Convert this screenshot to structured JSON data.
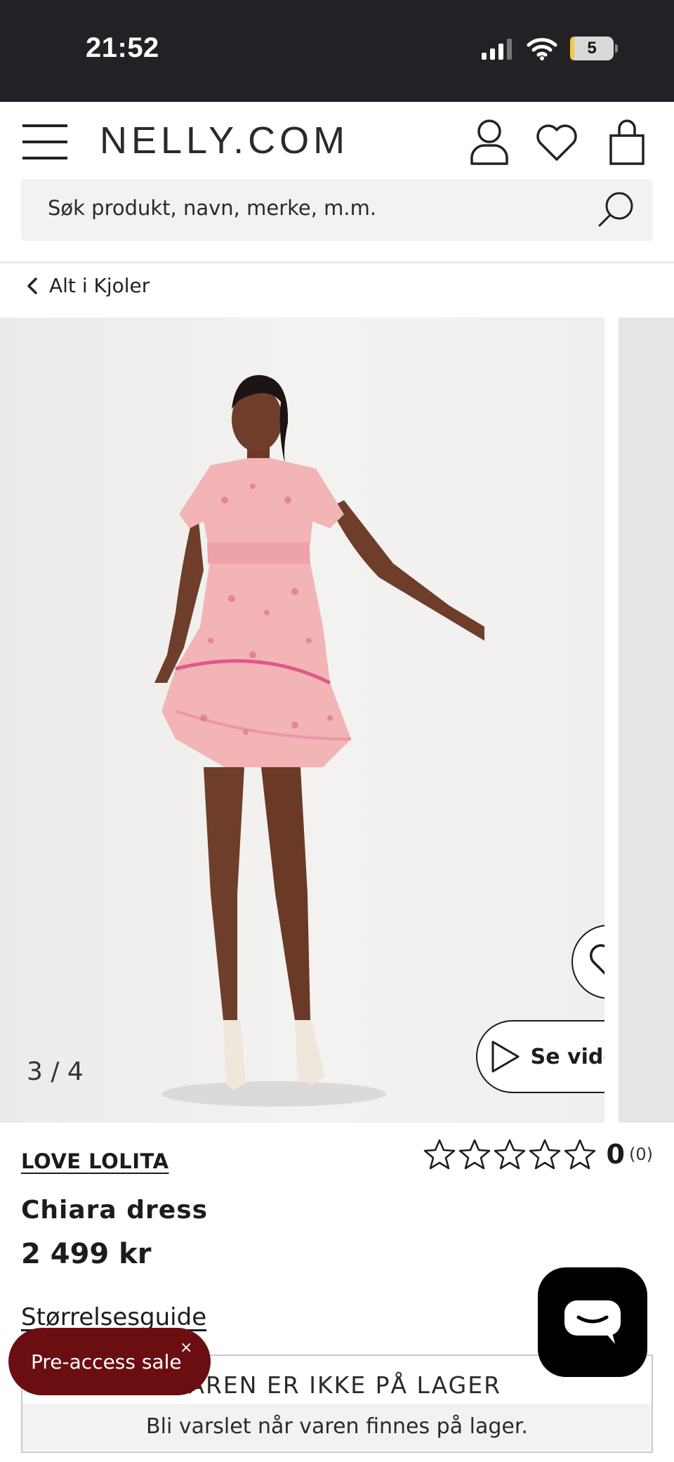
{
  "status_bar": {
    "time": "21:52",
    "battery": "5"
  },
  "header": {
    "logo": "NELLY.COM",
    "search_placeholder": "Søk produkt, navn, merke, m.m."
  },
  "breadcrumb": {
    "label": "Alt i Kjoler"
  },
  "gallery": {
    "counter": "3 / 4",
    "video_label": "Se video"
  },
  "product": {
    "brand": "LOVE LOLITA",
    "name": "Chiara dress",
    "price": "2 499 kr",
    "rating_value": "0",
    "rating_count": "(0)",
    "rating_stars": 0,
    "size_guide": "Størrelsesguide"
  },
  "stock": {
    "title": "VAREN ER IKKE PÅ LAGER",
    "subtitle": "Bli varslet når varen finnes på lager."
  },
  "promo": {
    "label": "Pre-access sale",
    "close": "×"
  },
  "colors": {
    "status_bar": "#222226",
    "promo_bg": "#6b0e12",
    "dress": "#f2b4b4"
  }
}
